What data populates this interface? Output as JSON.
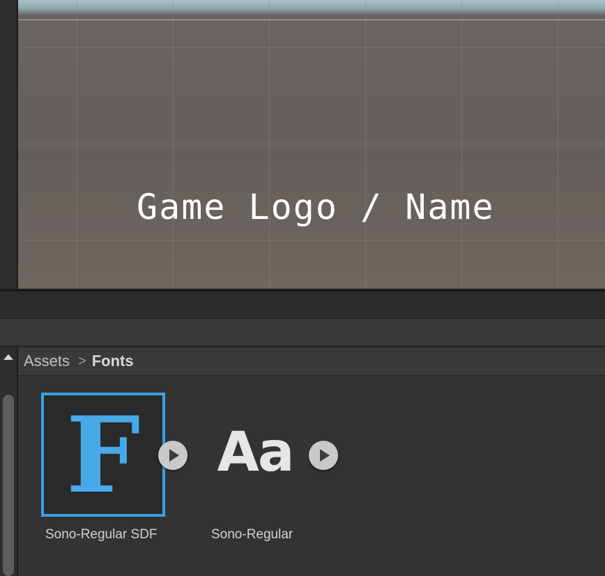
{
  "scene": {
    "title_text": "Game Logo / Name"
  },
  "project_browser": {
    "breadcrumb": {
      "root": "Assets",
      "separator": ">",
      "current": "Fonts"
    },
    "assets": [
      {
        "name": "Sono-Regular SDF",
        "icon": "font-asset-sdf-icon",
        "glyph": "F"
      },
      {
        "name": "Sono-Regular",
        "icon": "font-file-icon",
        "glyph": "Aa"
      }
    ]
  },
  "colors": {
    "sdf_accent": "#3aa0e5",
    "panel_bg": "#333333"
  }
}
